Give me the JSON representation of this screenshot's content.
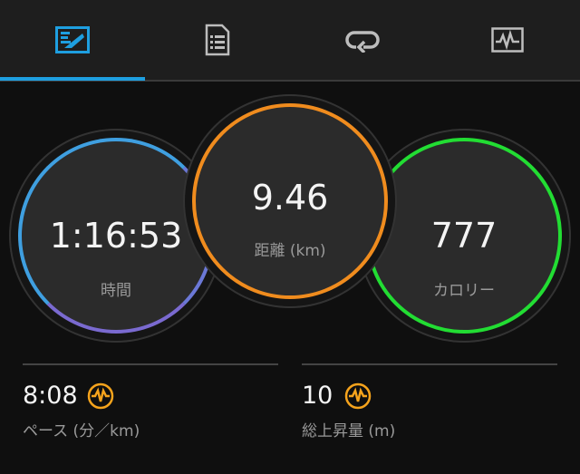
{
  "tabs": [
    {
      "icon": "activity-overview-icon",
      "active": true
    },
    {
      "icon": "document-list-icon",
      "active": false
    },
    {
      "icon": "laps-loop-icon",
      "active": false
    },
    {
      "icon": "chart-graph-icon",
      "active": false
    }
  ],
  "circles": {
    "time": {
      "value": "1:16:53",
      "label": "時間"
    },
    "distance": {
      "value": "9.46",
      "label": "距離 (km)"
    },
    "calories": {
      "value": "777",
      "label": "カロリー"
    }
  },
  "stats": {
    "pace": {
      "value": "8:08",
      "label": "ペース (分／km)"
    },
    "elevation": {
      "value": "10",
      "label": "総上昇量 (m)"
    }
  },
  "colors": {
    "accent_blue": "#1e9fe0",
    "distance_orange": "#f08c1e",
    "calories_green": "#22dd33",
    "time_blue_purple": "#6b78d6",
    "pulse_icon_orange": "#f5a31c"
  }
}
